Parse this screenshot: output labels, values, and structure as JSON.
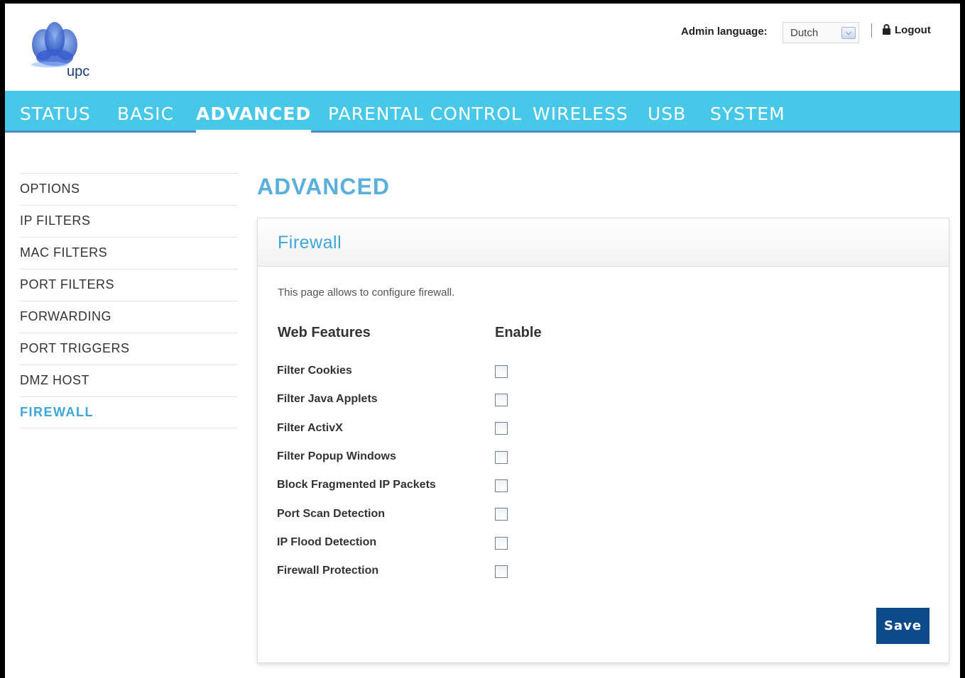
{
  "header": {
    "logo_text": "upc",
    "admin_language_label": "Admin language:",
    "admin_language_value": "Dutch",
    "logout_label": "Logout"
  },
  "nav": {
    "items": [
      "STATUS",
      "BASIC",
      "ADVANCED",
      "PARENTAL CONTROL",
      "WIRELESS",
      "USB",
      "SYSTEM"
    ],
    "active": "ADVANCED"
  },
  "sidebar": {
    "items": [
      "OPTIONS",
      "IP FILTERS",
      "MAC FILTERS",
      "PORT FILTERS",
      "FORWARDING",
      "PORT TRIGGERS",
      "DMZ HOST",
      "FIREWALL"
    ],
    "active": "FIREWALL"
  },
  "main": {
    "page_title": "ADVANCED",
    "panel_title": "Firewall",
    "description": "This page allows to configure firewall.",
    "col_features": "Web Features",
    "col_enable": "Enable",
    "rows": [
      {
        "label": "Filter Cookies",
        "checked": false
      },
      {
        "label": "Filter Java Applets",
        "checked": false
      },
      {
        "label": "Filter ActivX",
        "checked": false
      },
      {
        "label": "Filter Popup Windows",
        "checked": false
      },
      {
        "label": "Block Fragmented IP Packets",
        "checked": false
      },
      {
        "label": "Port Scan Detection",
        "checked": false
      },
      {
        "label": "IP Flood Detection",
        "checked": false
      },
      {
        "label": "Firewall Protection",
        "checked": false
      }
    ],
    "save_label": "Save"
  },
  "colors": {
    "nav_bg": "#48c8e8",
    "accent": "#3fa6d9",
    "save_button": "#0c4a8a"
  }
}
